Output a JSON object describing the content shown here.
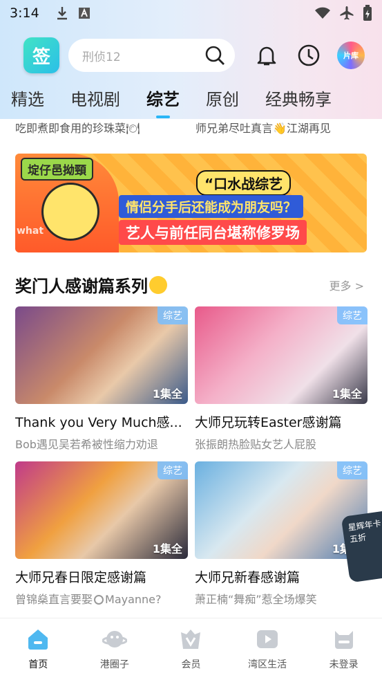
{
  "status_bar": {
    "time": "3:14"
  },
  "header": {
    "logo_text": "签",
    "search_placeholder": "刑侦12",
    "pianku_label": "片库"
  },
  "tabs": [
    {
      "label": "精选"
    },
    {
      "label": "电视剧"
    },
    {
      "label": "综艺",
      "active": true
    },
    {
      "label": "原创"
    },
    {
      "label": "经典畅享"
    }
  ],
  "prev_row": {
    "left": "吃即煮即食用的珍珠菜🍽",
    "right": "师兄弟尽吐真言👋江湖再见"
  },
  "banner": {
    "badge": "埞仔邑拗頸",
    "tag": "“口水战综艺",
    "line1": "情侣分手后还能成为朋友吗？",
    "line2": "艺人与前任同台堪称修罗场",
    "deco": "what"
  },
  "section": {
    "title": "奖门人感谢篇系列",
    "more": "更多 >"
  },
  "cards": [
    {
      "category": "综艺",
      "episodes": "1集全",
      "title": "Thank you Very Much感...",
      "subtitle": "Bob遇见吴若希被性缩力劝退"
    },
    {
      "category": "综艺",
      "episodes": "1集全",
      "title": "大师兄玩转Easter感谢篇",
      "subtitle": "张振朗热脸贴女艺人屁股"
    },
    {
      "category": "综艺",
      "episodes": "1集全",
      "title": "大师兄春日限定感谢篇",
      "subtitle_a": "曾锦燊直言要娶",
      "subtitle_b": "Mayanne?"
    },
    {
      "category": "综艺",
      "episodes": "1集全",
      "title": "大师兄新春感谢篇",
      "subtitle": "萧正楠“舞痴”惹全场爆笑"
    }
  ],
  "float_badge": {
    "text": "星辉年卡 五折"
  },
  "bottom_nav": [
    {
      "label": "首页",
      "icon": "home-icon",
      "active": true
    },
    {
      "label": "港圈子",
      "icon": "planet-icon"
    },
    {
      "label": "会员",
      "icon": "vip-icon"
    },
    {
      "label": "湾区生活",
      "icon": "play-icon"
    },
    {
      "label": "未登录",
      "icon": "cat-profile-icon"
    }
  ],
  "colors": {
    "accent": "#29b6f6",
    "category_badge": "#78beff",
    "banner_bg": "#ffb33a"
  }
}
